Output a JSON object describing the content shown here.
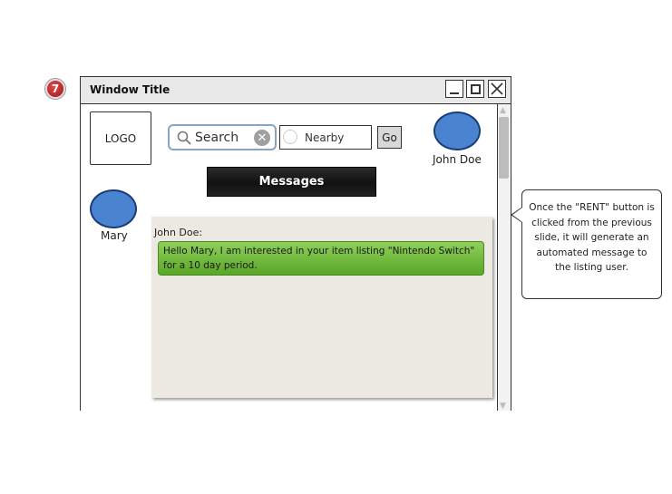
{
  "step_badge": "7",
  "window": {
    "title": "Window Title"
  },
  "logo": "LOGO",
  "search": {
    "value": "Search"
  },
  "nearby": {
    "value": "Nearby"
  },
  "go_label": "Go",
  "users": {
    "current": "John Doe",
    "recipient": "Mary"
  },
  "messages_label": "Messages",
  "chat": {
    "sender": "John Doe:",
    "message": "Hello Mary, I am interested in your item listing \"Nintendo Switch\" for a 10 day period."
  },
  "callout": "Once the \"RENT\" button is clicked from the previous slide, it will generate an automated message to the listing user.",
  "colors": {
    "avatar": "#4a84d0",
    "bubble": "#6cba3a",
    "chat_bg": "#ece9e2"
  },
  "icons": [
    "search-icon",
    "clear-icon",
    "location-icon",
    "minimize-icon",
    "maximize-icon",
    "close-icon"
  ]
}
